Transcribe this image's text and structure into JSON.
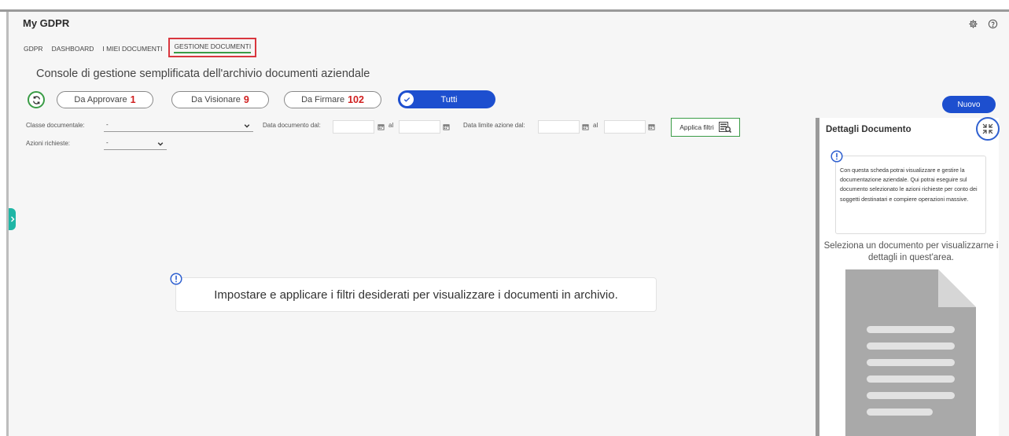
{
  "app": {
    "title": "My GDPR"
  },
  "nav": {
    "tabs": [
      {
        "label": "GDPR"
      },
      {
        "label": "DASHBOARD"
      },
      {
        "label": "I MIEI DOCUMENTI"
      },
      {
        "label": "GESTIONE DOCUMENTI",
        "active": true
      }
    ]
  },
  "console": {
    "title": "Console di gestione semplificata dell'archivio documenti aziendale"
  },
  "status_filters": {
    "approvare": {
      "label": "Da Approvare",
      "count": "1"
    },
    "visionare": {
      "label": "Da Visionare",
      "count": "9"
    },
    "firmare": {
      "label": "Da Firmare",
      "count": "102"
    },
    "tutti": {
      "label": "Tutti",
      "selected": true
    }
  },
  "nuovo_button": "Nuovo",
  "filters": {
    "classe_label": "Classe documentale:",
    "classe_value": "-",
    "data_doc_label": "Data documento dal:",
    "al_label": "al",
    "data_limite_label": "Data limite azione dal:",
    "azioni_label": "Azioni richieste:",
    "azioni_value": "-",
    "applica_label": "Applica filtri"
  },
  "empty_state": {
    "message": "Impostare e applicare i filtri desiderati per visualizzare i documenti in archivio."
  },
  "details_panel": {
    "title": "Dettagli Documento",
    "info": "Con questa scheda potrai visualizzare e gestire la documentazione aziendale. Qui potrai eseguire sul documento selezionato le azioni richieste per conto dei soggetti destinatari e compiere operazioni massive.",
    "select_message": "Seleziona un documento per visualizzarne i dettagli in quest'area."
  },
  "icons": {
    "settings": "gear-icon",
    "help": "help-icon",
    "refresh": "refresh-icon",
    "check": "check-icon",
    "calendar": "calendar-icon",
    "filter": "filter-icon",
    "info": "info-icon",
    "collapse": "collapse-icon",
    "expand_handle": "chevron-right-icon",
    "document": "document-icon"
  },
  "colors": {
    "accent_blue": "#1d4fcf",
    "accent_green": "#3a9c46",
    "count_red": "#d01f1f",
    "active_tab_border": "#d9363e",
    "handle_teal": "#1fb6a6"
  }
}
